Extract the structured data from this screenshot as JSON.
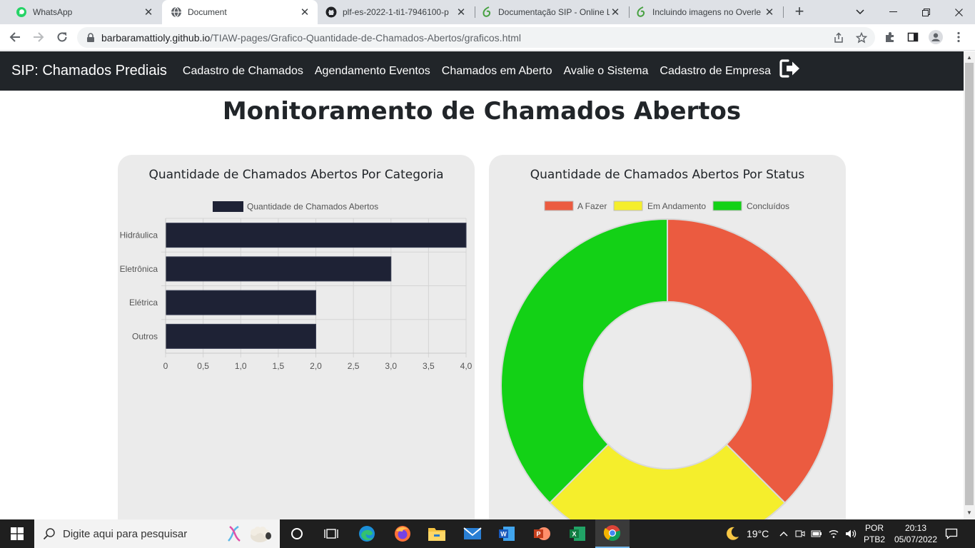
{
  "browser": {
    "tabs": [
      {
        "title": "WhatsApp",
        "icon": "whatsapp-icon",
        "active": false
      },
      {
        "title": "Document",
        "icon": "globe-icon",
        "active": true
      },
      {
        "title": "plf-es-2022-1-ti1-7946100-p",
        "icon": "github-icon",
        "active": false
      },
      {
        "title": "Documentação SIP - Online L",
        "icon": "overleaf-icon",
        "active": false
      },
      {
        "title": "Incluindo imagens no Overle",
        "icon": "overleaf-icon",
        "active": false
      }
    ],
    "url_host": "barbaramattioly.github.io",
    "url_path": "/TIAW-pages/Grafico-Quantidade-de-Chamados-Abertos/graficos.html"
  },
  "navbar": {
    "brand": "SIP: Chamados Prediais",
    "links": [
      "Cadastro de Chamados",
      "Agendamento Eventos",
      "Chamados em Aberto",
      "Avalie o Sistema",
      "Cadastro de Empresa"
    ]
  },
  "page": {
    "title": "Monitoramento de Chamados Abertos"
  },
  "chart_data": [
    {
      "type": "bar",
      "orientation": "horizontal",
      "title": "Quantidade de Chamados Abertos Por Categoria",
      "categories": [
        "Hidráulica",
        "Eletrônica",
        "Elétrica",
        "Outros"
      ],
      "series": [
        {
          "name": "Quantidade de Chamados Abertos",
          "values": [
            4,
            3,
            2,
            2
          ],
          "color": "#1e2235"
        }
      ],
      "xlim": [
        0,
        4
      ],
      "xticks": [
        "0",
        "0,5",
        "1,0",
        "1,5",
        "2,0",
        "2,5",
        "3,0",
        "3,5",
        "4,0"
      ],
      "grid": true,
      "legend": "top"
    },
    {
      "type": "pie",
      "variant": "doughnut",
      "title": "Quantidade de Chamados Abertos Por Status",
      "labels": [
        "A Fazer",
        "Em Andamento",
        "Concluídos"
      ],
      "values": [
        3,
        2,
        3
      ],
      "colors": [
        "#eb5b40",
        "#f5ee2c",
        "#13d116"
      ],
      "legend": "top"
    }
  ],
  "taskbar": {
    "search_placeholder": "Digite aqui para pesquisar",
    "weather": "19°C",
    "lang_top": "POR",
    "lang_bottom": "PTB2",
    "time": "20:13",
    "date": "05/07/2022"
  },
  "colors": {
    "navbar_bg": "#212529",
    "card_bg": "#ebebeb"
  }
}
